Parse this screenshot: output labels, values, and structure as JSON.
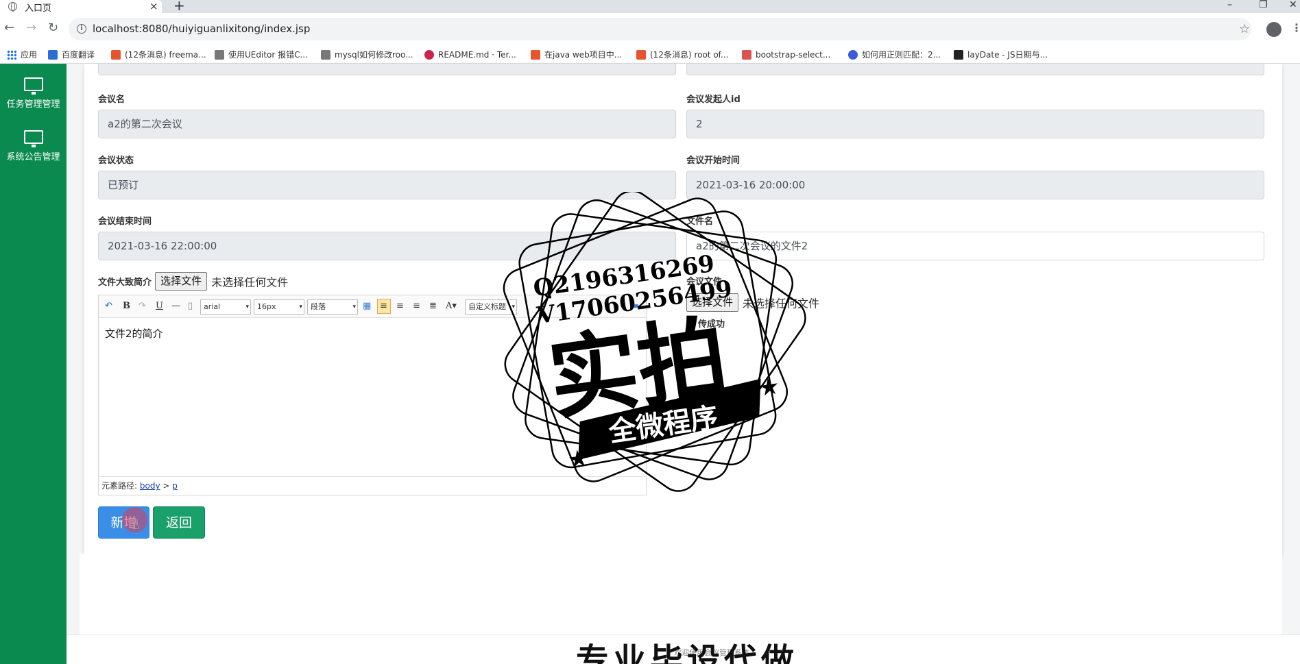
{
  "browser": {
    "tab_title": "入口页",
    "tab_close": "×",
    "new_tab": "+",
    "url": "localhost:8080/huiyiguanlixitong/index.jsp",
    "back": "←",
    "forward": "→",
    "reload": "↻",
    "star": "☆",
    "menu": "⋮",
    "info": "i",
    "win_min": "–",
    "win_restore": "❐",
    "win_close": "✕",
    "bookmarks": [
      {
        "label": "应用",
        "color": "#1a73e8"
      },
      {
        "label": "百度翻译",
        "color": "#2b6fd6"
      },
      {
        "label": "(12条消息) freema...",
        "color": "#e4572e"
      },
      {
        "label": "使用UEditor 报错C...",
        "color": "#555555"
      },
      {
        "label": "mysql如何修改roo...",
        "color": "#555555"
      },
      {
        "label": "README.md · Ter...",
        "color": "#c7254e"
      },
      {
        "label": "在java web项目中...",
        "color": "#e4572e"
      },
      {
        "label": "(12条消息) root of...",
        "color": "#e4572e"
      },
      {
        "label": "bootstrap-select...",
        "color": "#d9534f"
      },
      {
        "label": "如何用正则匹配：2...",
        "color": "#3b5bdb"
      },
      {
        "label": "layDate - JS日期与...",
        "color": "#222222"
      }
    ]
  },
  "sidebar": {
    "items": [
      {
        "label": "任务管理管理",
        "icon": "monitor-icon"
      },
      {
        "label": "系统公告管理",
        "icon": "monitor-icon"
      }
    ]
  },
  "form": {
    "meeting_name_label": "会议名",
    "meeting_name_value": "a2的第二次会议",
    "initiator_label": "会议发起人id",
    "initiator_value": "2",
    "status_label": "会议状态",
    "status_value": "已预订",
    "start_label": "会议开始时间",
    "start_value": "2021-03-16 20:00:00",
    "end_label": "会议结束时间",
    "end_value": "2021-03-16 22:00:00",
    "file_name_label": "文件名",
    "file_name_value": "a2的第二次会议的文件2",
    "summary_label": "文件大致简介",
    "choose_file": "选择文件",
    "no_file": "未选择任何文件",
    "meeting_file_label": "会议文件",
    "upload_status": "传成功",
    "editor": {
      "font": "arial",
      "size": "16px",
      "paragraph": "段落",
      "custom_title": "自定义标题",
      "content": "文件2的简介",
      "path_label": "元素路径:",
      "path_body": "body",
      "path_sep": ">",
      "path_p": "p"
    },
    "add_button": "新增",
    "back_button": "返回"
  },
  "footer": {
    "text": "欢迎使用会议管理系统"
  },
  "watermark": {
    "line1": "Q2196316269",
    "line2": "V17060256499",
    "big": "实拍",
    "banner": "全微程序",
    "bottom": "专业毕设代做"
  }
}
